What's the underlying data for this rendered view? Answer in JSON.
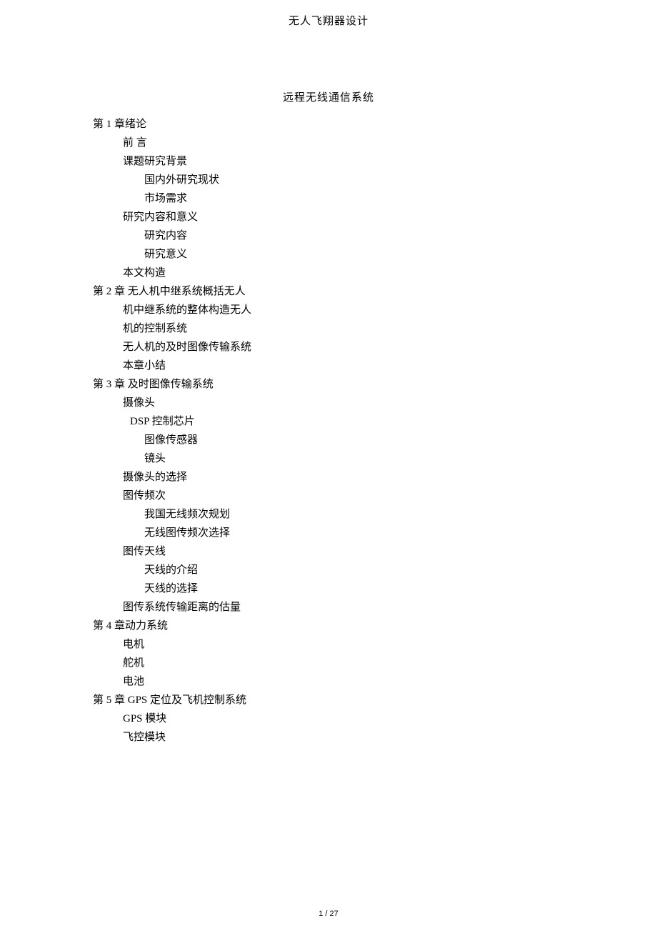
{
  "header": {
    "title": "无人飞翔器设计"
  },
  "subtitle": "远程无线通信系统",
  "toc": [
    {
      "level": 0,
      "text": "第 1 章绪论"
    },
    {
      "level": 1,
      "text": "前 言"
    },
    {
      "level": 1,
      "text": "课题研究背景"
    },
    {
      "level": 2,
      "text": "国内外研究现状"
    },
    {
      "level": 2,
      "text": "市场需求"
    },
    {
      "level": 1,
      "text": "研究内容和意义"
    },
    {
      "level": 2,
      "text": "研究内容"
    },
    {
      "level": 2,
      "text": "研究意义"
    },
    {
      "level": 1,
      "text": "本文构造"
    },
    {
      "level": 0,
      "text": "第 2 章  无人机中继系统概括无人"
    },
    {
      "level": 1,
      "text": "机中继系统的整体构造无人"
    },
    {
      "level": 1,
      "text": "机的控制系统"
    },
    {
      "level": 1,
      "text": "无人机的及时图像传输系统"
    },
    {
      "level": 1,
      "text": "本章小结"
    },
    {
      "level": 0,
      "text": "第 3 章  及时图像传输系统"
    },
    {
      "level": 1,
      "text": "摄像头"
    },
    {
      "level": "1b",
      "text": "DSP    控制芯片"
    },
    {
      "level": 2,
      "text": "图像传感器"
    },
    {
      "level": 2,
      "text": "镜头"
    },
    {
      "level": 1,
      "text": "摄像头的选择"
    },
    {
      "level": 1,
      "text": "图传频次"
    },
    {
      "level": 2,
      "text": "我国无线频次规划"
    },
    {
      "level": 2,
      "text": "无线图传频次选择"
    },
    {
      "level": 1,
      "text": "图传天线"
    },
    {
      "level": 2,
      "text": "天线的介绍"
    },
    {
      "level": 2,
      "text": "天线的选择"
    },
    {
      "level": 1,
      "text": "图传系统传输距离的估量"
    },
    {
      "level": 0,
      "text": "第 4 章动力系统"
    },
    {
      "level": 1,
      "text": "电机"
    },
    {
      "level": 1,
      "text": "舵机"
    },
    {
      "level": 1,
      "text": "电池"
    },
    {
      "level": 0,
      "text": "第 5 章 GPS 定位及飞机控制系统"
    },
    {
      "level": 1,
      "text": "GPS 模块"
    },
    {
      "level": 1,
      "text": "飞控模块"
    }
  ],
  "footer": {
    "page": "1 / 27"
  }
}
